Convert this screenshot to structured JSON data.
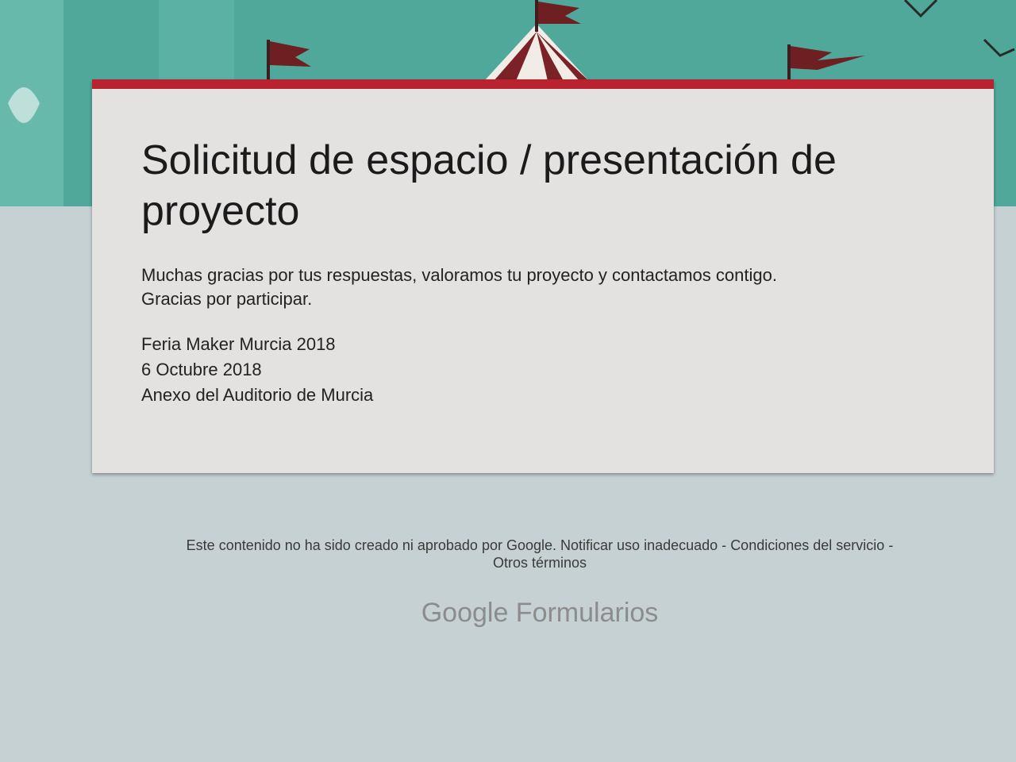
{
  "colors": {
    "banner_teal": "#4fa89a",
    "accent_red": "#b8232f",
    "card_bg": "#e4e1e1",
    "page_bg": "#c5d1d3"
  },
  "form": {
    "title": "Solicitud de espacio / presentación de proyecto",
    "confirmation": [
      "Muchas gracias por tus respuestas, valoramos tu proyecto y contactamos contigo.",
      "Gracias por participar."
    ],
    "event": [
      "Feria Maker Murcia 2018",
      "6 Octubre 2018",
      "Anexo del Auditorio de Murcia"
    ]
  },
  "footer": {
    "disclaimer": "Este contenido no ha sido creado ni aprobado por Google.",
    "report_link": "Notificar uso inadecuado",
    "separator": "-",
    "terms_link": "Condiciones del servicio",
    "other_terms_link": "Otros términos",
    "logo": "Google Formularios"
  },
  "icons": {
    "banner_decoration": "circus-tent-flags-icon"
  }
}
